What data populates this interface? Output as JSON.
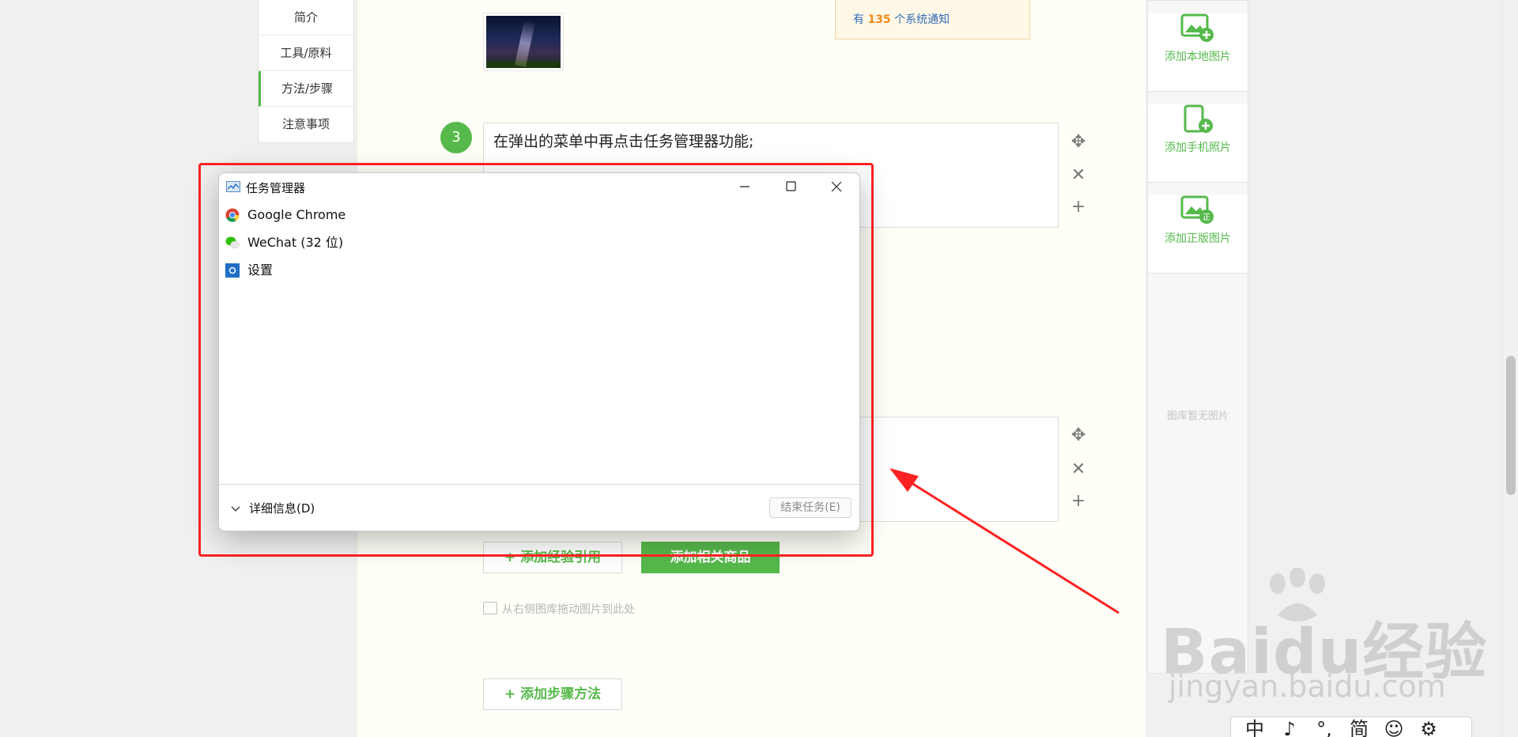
{
  "left_nav": {
    "items": [
      "简介",
      "工具/原料",
      "方法/步骤",
      "注意事项"
    ],
    "active_index": 2
  },
  "notification": {
    "prefix": "有",
    "count": "135",
    "suffix": "个系统通知"
  },
  "step": {
    "number": "3",
    "text": "在弹出的菜单中再点击任务管理器功能;"
  },
  "buttons": {
    "add_reference": "+ 添加经验引用",
    "add_product": "添加相关商品",
    "add_step": "+ 添加步骤方法"
  },
  "drop_hint": "从右侧图库拖动图片到此处",
  "right_panel": {
    "items": [
      {
        "label": "添加本地图片",
        "icon": "image-add-icon"
      },
      {
        "label": "添加手机照片",
        "icon": "phone-add-icon"
      },
      {
        "label": "添加正版图片",
        "icon": "image-licensed-icon"
      }
    ],
    "empty_text": "图库暂无图片"
  },
  "task_manager": {
    "title": "任务管理器",
    "processes": [
      {
        "name": "Google Chrome",
        "icon": "chrome-icon"
      },
      {
        "name": "WeChat (32 位)",
        "icon": "wechat-icon"
      },
      {
        "name": "设置",
        "icon": "settings-icon"
      }
    ],
    "details_label": "详细信息(D)",
    "end_task_label": "结束任务(E)"
  },
  "watermark": {
    "main": "Baidu经验",
    "sub": "jingyan.baidu.com"
  },
  "ime_bar": {
    "items": [
      "中",
      "♪",
      "°,",
      "简",
      "☺",
      "⚙"
    ]
  },
  "colors": {
    "accent_green": "#56b94b",
    "highlight_red": "#ff2222",
    "notify_orange": "#f08c1a"
  }
}
